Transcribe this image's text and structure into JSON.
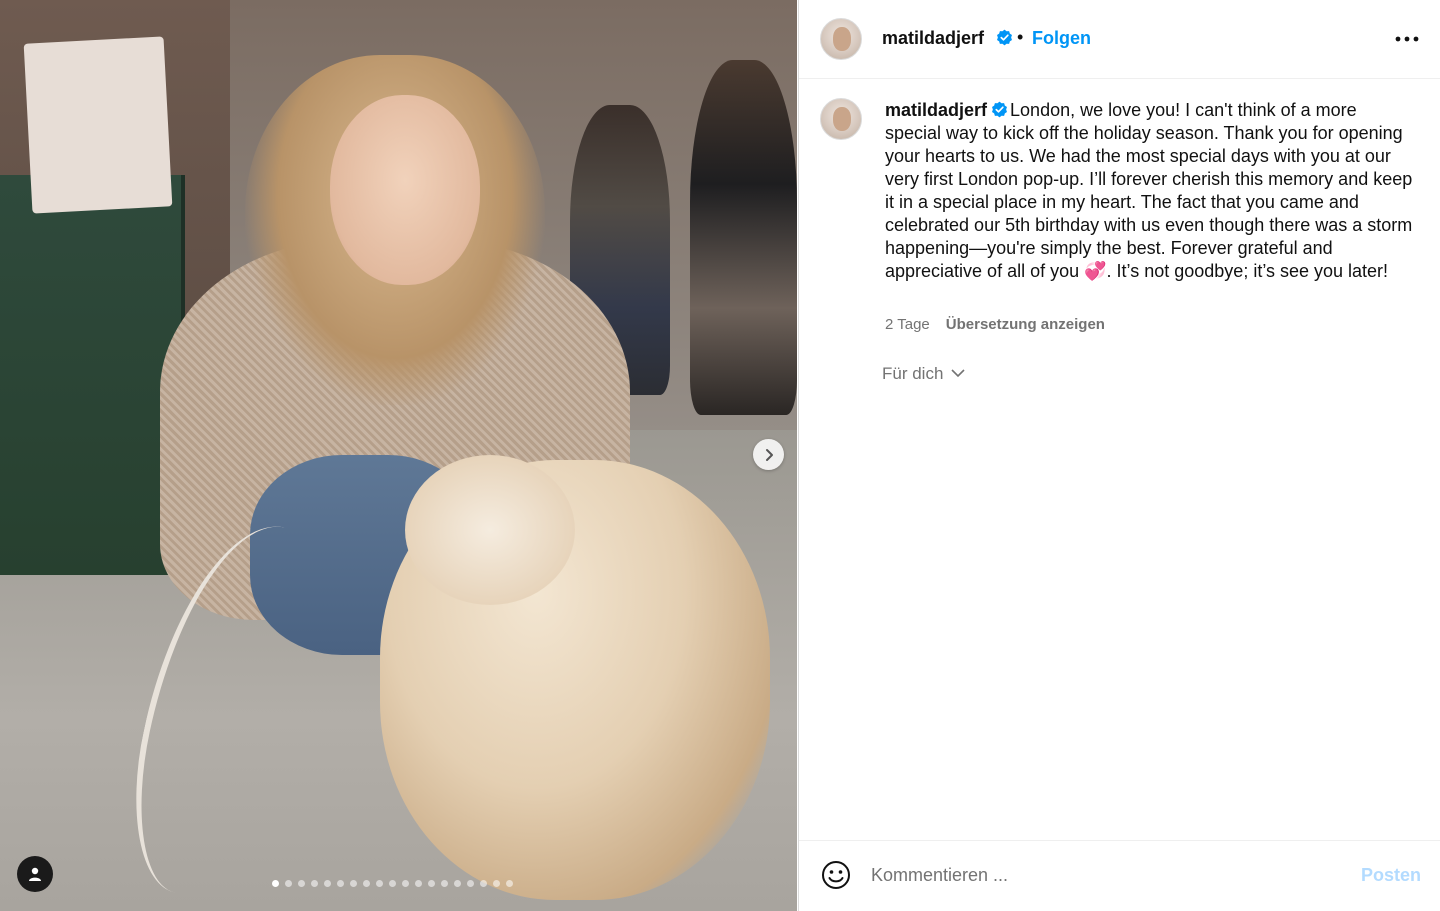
{
  "media": {
    "carousel_total": 19,
    "carousel_active_index": 0
  },
  "header": {
    "username": "matildadjerf",
    "separator": "•",
    "follow_label": "Folgen"
  },
  "caption": {
    "username": "matildadjerf",
    "text_before_emoji": "London, we love you! I can't think of a more special way to kick off the holiday season. Thank you for opening your hearts to us. We had the most special days with you at our very first London pop-up. I’ll forever cherish this memory and keep it in a special place in my heart. The fact that you came and celebrated our 5th birthday with us even though there was a storm happening—you're simply the best. Forever grateful and appreciative of all of you ",
    "emoji": "💞",
    "text_after_emoji": ". It’s not goodbye; it’s see you later!"
  },
  "meta": {
    "timestamp": "2 Tage",
    "translate_label": "Übersetzung anzeigen"
  },
  "for_you_label": "Für dich",
  "comment": {
    "placeholder": "Kommentieren ...",
    "post_label": "Posten"
  },
  "colors": {
    "accent": "#0095f6",
    "post_disabled": "#b3dbff",
    "verified": "#0095f6"
  }
}
